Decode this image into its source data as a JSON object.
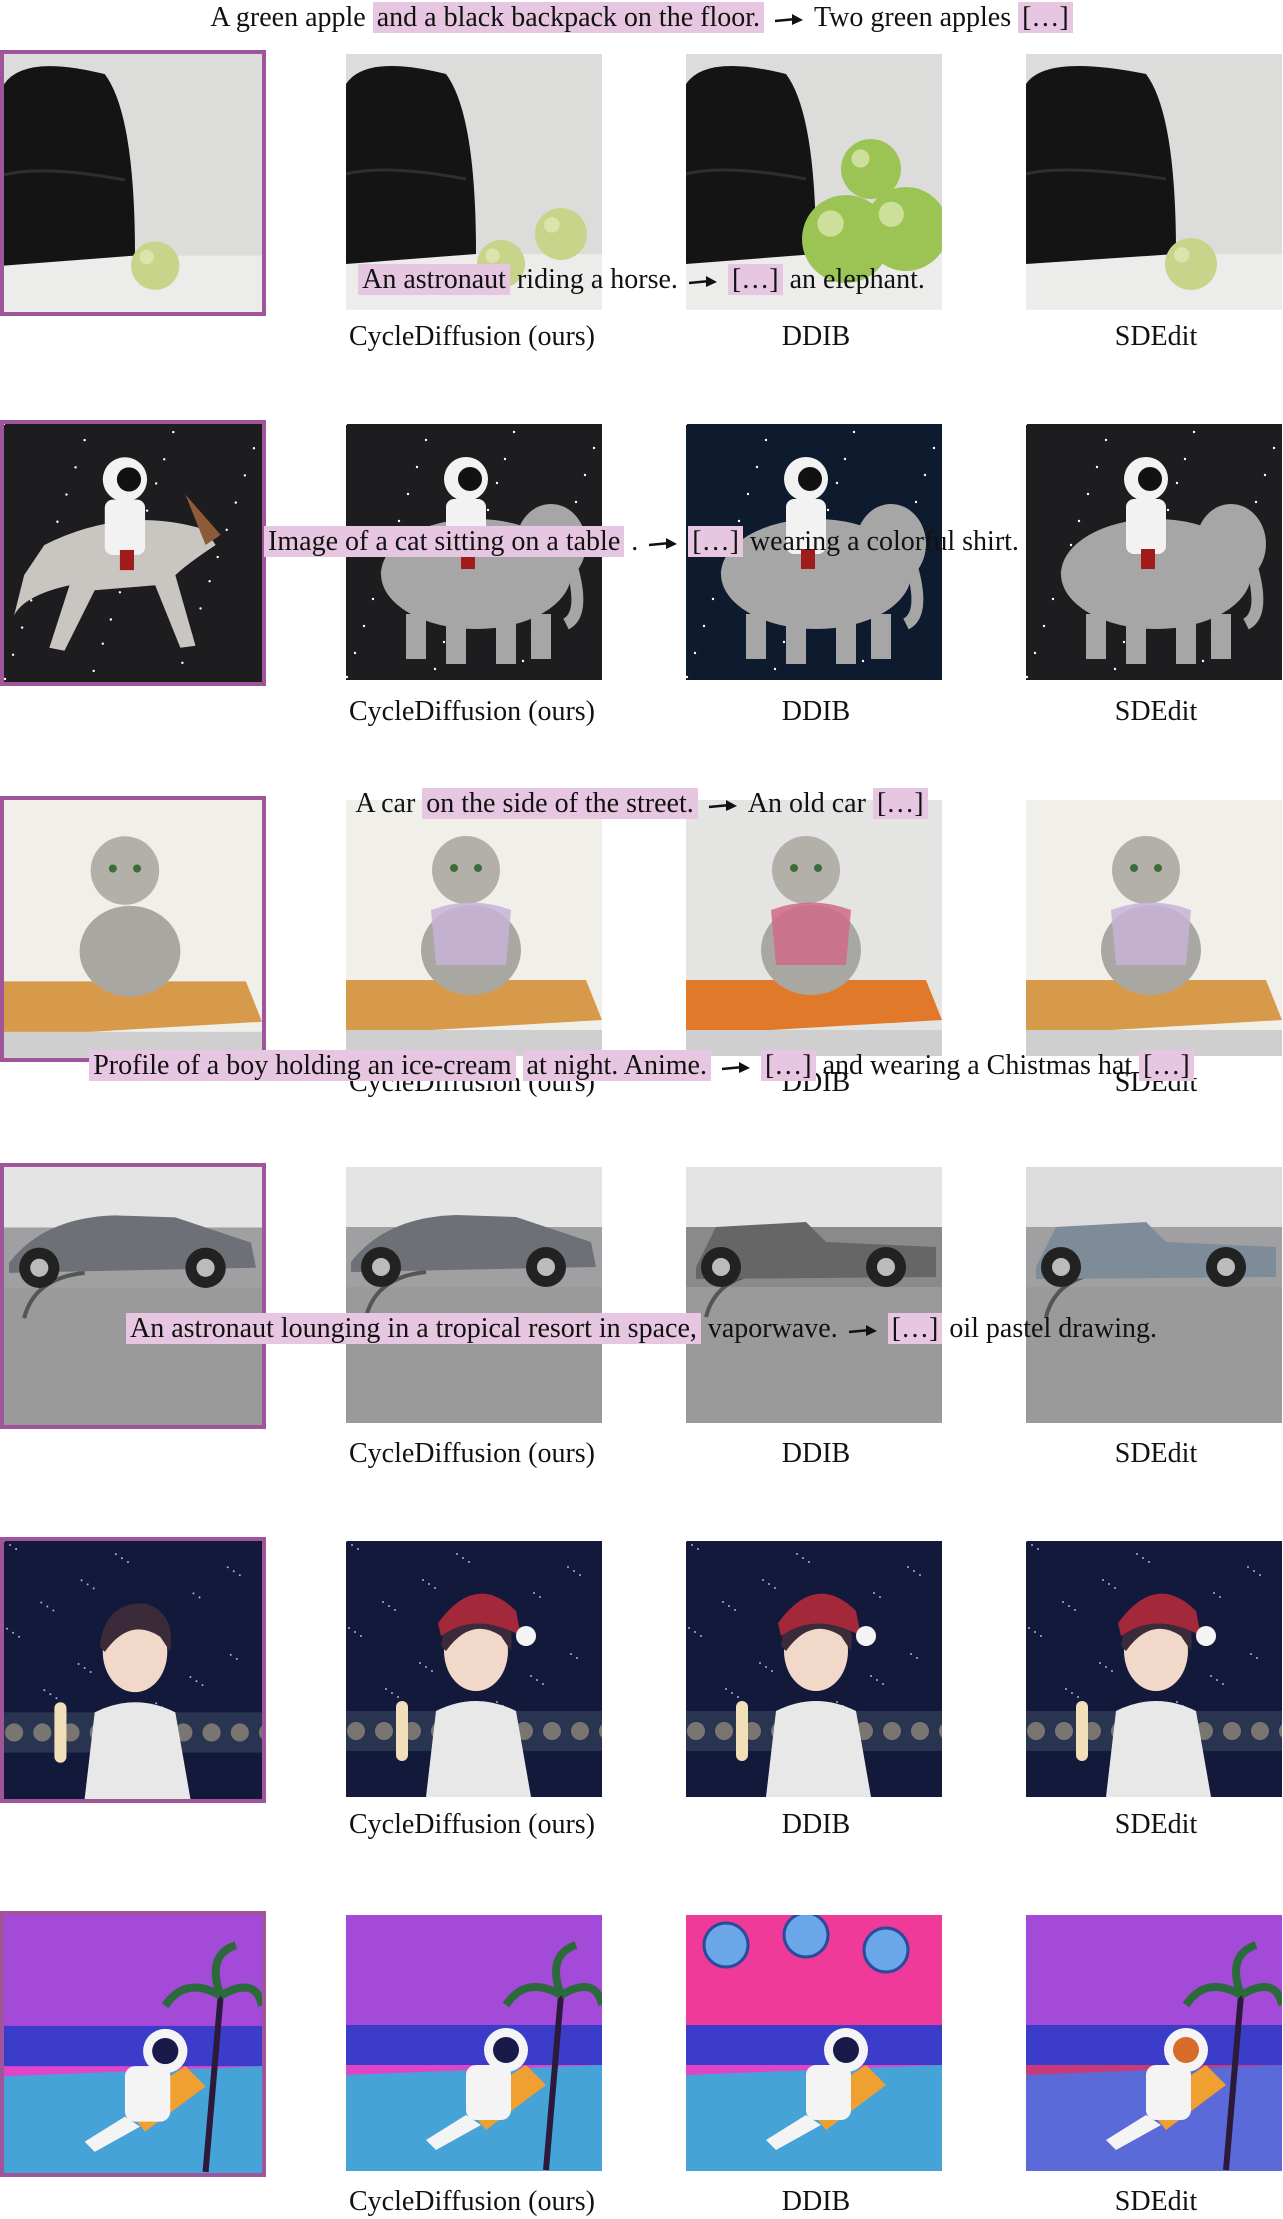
{
  "rows": [
    {
      "caption": [
        {
          "text": "A green apple ",
          "hl": false
        },
        {
          "text": "and a black backpack on the floor.",
          "hl": true
        },
        {
          "arrow": true
        },
        {
          "text": "Two green apples ",
          "hl": false
        },
        {
          "text": "[…]",
          "hl": true
        }
      ],
      "labels": [
        "CycleDiffusion (ours)",
        "DDIB",
        "SDEdit"
      ],
      "scene": "apple"
    },
    {
      "caption": [
        {
          "text": "An astronaut",
          "hl": true
        },
        {
          "text": " riding a horse.",
          "hl": false
        },
        {
          "arrow": true
        },
        {
          "text": "[…]",
          "hl": true
        },
        {
          "text": " an elephant.",
          "hl": false
        }
      ],
      "labels": [
        "CycleDiffusion (ours)",
        "DDIB",
        "SDEdit"
      ],
      "scene": "astronaut"
    },
    {
      "caption": [
        {
          "text": "Image of a cat sitting on a table",
          "hl": true
        },
        {
          "text": " .",
          "hl": false
        },
        {
          "arrow": true
        },
        {
          "text": "[…]",
          "hl": true
        },
        {
          "text": " wearing a colorful shirt.",
          "hl": false
        }
      ],
      "labels": [
        "CycleDiffusion (ours)",
        "DDIB",
        "SDEdit"
      ],
      "scene": "cat"
    },
    {
      "caption": [
        {
          "text": "A car ",
          "hl": false
        },
        {
          "text": "on the side of the street.",
          "hl": true
        },
        {
          "arrow": true
        },
        {
          "text": "An old car ",
          "hl": false
        },
        {
          "text": "[…]",
          "hl": true
        }
      ],
      "labels": [
        "CycleDiffusion (ours)",
        "DDIB",
        "SDEdit"
      ],
      "scene": "car"
    },
    {
      "caption": [
        {
          "text": "Profile of a boy holding an ice-cream",
          "hl": true
        },
        {
          "text": " ",
          "hl": false
        },
        {
          "text": "at night. Anime.",
          "hl": true
        },
        {
          "arrow": true
        },
        {
          "text": "[…]",
          "hl": true
        },
        {
          "text": " and wearing a Chistmas hat ",
          "hl": false
        },
        {
          "text": "[…]",
          "hl": true
        }
      ],
      "labels": [
        "CycleDiffusion (ours)",
        "DDIB",
        "SDEdit"
      ],
      "scene": "boy"
    },
    {
      "caption": [
        {
          "text": "An astronaut lounging in a tropical resort in space,",
          "hl": true
        },
        {
          "text": " vaporwave.",
          "hl": false
        },
        {
          "arrow": true
        },
        {
          "text": "[…]",
          "hl": true
        },
        {
          "text": " oil pastel drawing.",
          "hl": false
        }
      ],
      "labels": [
        "CycleDiffusion (ours)",
        "DDIB",
        "SDEdit"
      ],
      "scene": "resort"
    }
  ],
  "colors": {
    "highlight": "#e6c6e0",
    "source_border": "#a0549a"
  }
}
